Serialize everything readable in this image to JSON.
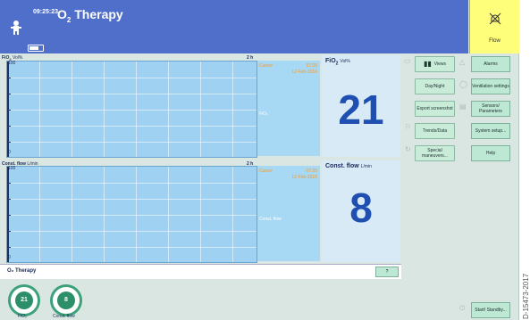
{
  "header": {
    "clock": "09:25:23",
    "title_prefix": "O",
    "title_sub": "2",
    "title_suffix": " Therapy",
    "flow_label": "Flow"
  },
  "curves": {
    "fio2": {
      "label_main": "FiO",
      "label_sub": "2",
      "unit": "Vol%",
      "time_span": "2 h",
      "y_max": "100",
      "y_min": "0",
      "cursor_label": "Cursor",
      "cursor_time": "07:25",
      "cursor_date": "12-Feb-2016",
      "field": "FiO₂"
    },
    "flow": {
      "label": "Const. flow",
      "unit": "L/min",
      "time_span": "2 h",
      "y_max": "100",
      "y_min": "0",
      "cursor_label": "Cursor",
      "cursor_time": "07:25",
      "cursor_date": "12-Feb-2016",
      "field": "Const. flow"
    }
  },
  "values": {
    "fio2": {
      "label_main": "FiO",
      "label_sub": "2",
      "unit": "Vol%",
      "value": "21"
    },
    "flow": {
      "label": "Const. flow",
      "unit": "L/min",
      "value": "8"
    }
  },
  "menu": [
    {
      "label": "Views"
    },
    {
      "label": "Day/Night"
    },
    {
      "label": "Export screenshot"
    },
    {
      "label": "Trends/Data"
    },
    {
      "label": "Special maneuvers..."
    }
  ],
  "right_menu": [
    {
      "label": "Alarms"
    },
    {
      "label": "Ventilation settings"
    },
    {
      "label": "Sensors/ Parameters"
    },
    {
      "label": "System setup..."
    },
    {
      "label": "Help"
    },
    {
      "label": "Start/ Standby..."
    }
  ],
  "bottom": {
    "mode": "O₂ Therapy",
    "help_button": "?",
    "knobs": [
      {
        "value": "21",
        "label": "FiO₂"
      },
      {
        "value": "8",
        "label": "Const. flow"
      }
    ]
  },
  "watermark": "D-15473-2017",
  "icons": {
    "patient": "baby-icon",
    "flow": "alarm-off-icon",
    "views": "views-icon"
  },
  "colors": {
    "header": "#4f6fca",
    "flow_box": "#fffe7a",
    "plot": "#9fd2f2",
    "value_text": "#1f4fb0",
    "button": "#bde8d3"
  }
}
